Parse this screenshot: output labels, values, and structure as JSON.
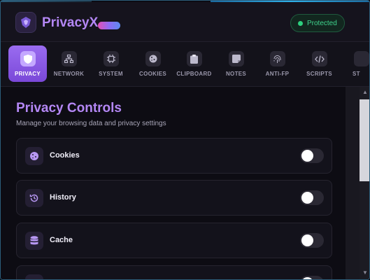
{
  "header": {
    "app_title": "PrivacyX",
    "status": "Protected"
  },
  "tabs": [
    {
      "label": "PRIVACY",
      "icon": "shield-icon",
      "active": true
    },
    {
      "label": "NETWORK",
      "icon": "network-icon",
      "active": false
    },
    {
      "label": "SYSTEM",
      "icon": "chip-icon",
      "active": false
    },
    {
      "label": "COOKIES",
      "icon": "cookie-icon",
      "active": false
    },
    {
      "label": "CLIPBOARD",
      "icon": "clipboard-icon",
      "active": false
    },
    {
      "label": "NOTES",
      "icon": "note-icon",
      "active": false
    },
    {
      "label": "ANTI-FP",
      "icon": "fingerprint-icon",
      "active": false
    },
    {
      "label": "SCRIPTS",
      "icon": "code-icon",
      "active": false
    },
    {
      "label": "ST",
      "icon": "settings-icon",
      "active": false
    }
  ],
  "main": {
    "title": "Privacy Controls",
    "subtitle": "Manage your browsing data and privacy settings",
    "controls": [
      {
        "label": "Cookies",
        "icon": "cookie-icon",
        "enabled": false
      },
      {
        "label": "History",
        "icon": "history-icon",
        "enabled": false
      },
      {
        "label": "Cache",
        "icon": "database-icon",
        "enabled": false
      },
      {
        "label": "",
        "icon": "item-icon",
        "enabled": false
      }
    ]
  },
  "colors": {
    "accent": "#b487f5",
    "active_tab": "#8a5be6",
    "status_green": "#2dd07e"
  }
}
